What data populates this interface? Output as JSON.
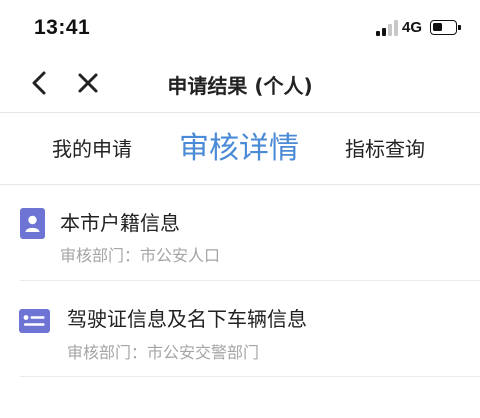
{
  "status_bar": {
    "time": "13:41",
    "network": "4G",
    "battery_level": 0.45
  },
  "nav": {
    "title": "申请结果 (个人)"
  },
  "tabs": [
    {
      "label": "我的申请",
      "active": false
    },
    {
      "label": "审核详情",
      "active": true
    },
    {
      "label": "指标查询",
      "active": false
    }
  ],
  "records": [
    {
      "icon": "user-card-icon",
      "title": "本市户籍信息",
      "department": "审核部门：市公安人口"
    },
    {
      "icon": "license-card-icon",
      "title": "驾驶证信息及名下车辆信息",
      "department": "审核部门：市公安交警部门"
    }
  ],
  "colors": {
    "accent": "#4a8ad6",
    "icon_purple": "#6e74d4",
    "subtext": "#a5a5a5"
  }
}
